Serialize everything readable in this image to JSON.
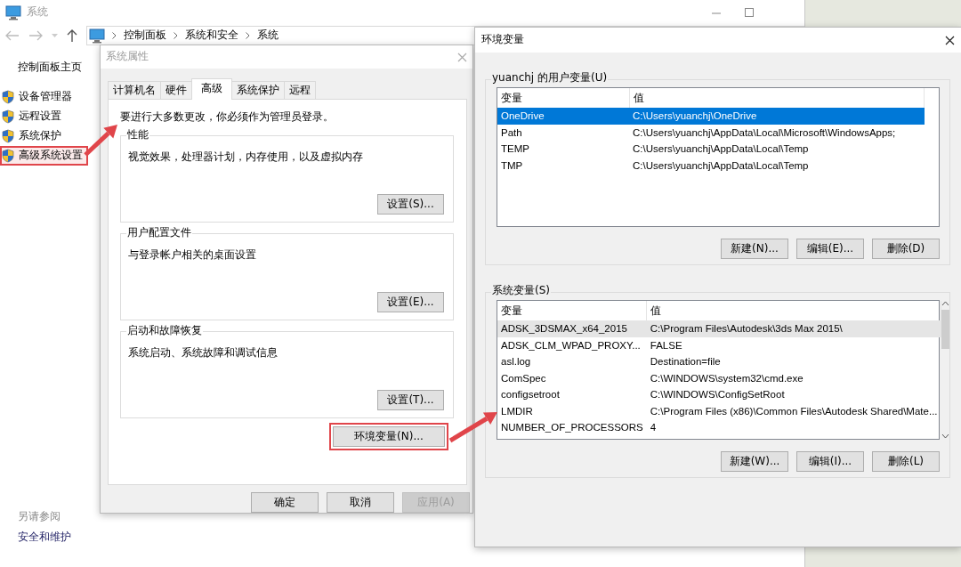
{
  "system_window": {
    "title": "系统",
    "breadcrumb": [
      "控制面板",
      "系统和安全",
      "系统"
    ],
    "sidebar": {
      "home": "控制面板主页",
      "items": [
        {
          "label": "设备管理器",
          "highlighted": false
        },
        {
          "label": "远程设置",
          "highlighted": false
        },
        {
          "label": "系统保护",
          "highlighted": false
        },
        {
          "label": "高级系统设置",
          "highlighted": true
        }
      ],
      "see_also": "另请参阅",
      "links": [
        "安全和维护"
      ]
    }
  },
  "properties_dialog": {
    "title": "系统属性",
    "tabs": [
      {
        "label": "计算机名",
        "selected": false
      },
      {
        "label": "硬件",
        "selected": false
      },
      {
        "label": "高级",
        "selected": true
      },
      {
        "label": "系统保护",
        "selected": false
      },
      {
        "label": "远程",
        "selected": false
      }
    ],
    "notice": "要进行大多数更改，你必须作为管理员登录。",
    "groups": [
      {
        "title": "性能",
        "description": "视觉效果，处理器计划，内存使用，以及虚拟内存",
        "button": "设置(S)..."
      },
      {
        "title": "用户配置文件",
        "description": "与登录帐户相关的桌面设置",
        "button": "设置(E)..."
      },
      {
        "title": "启动和故障恢复",
        "description": "系统启动、系统故障和调试信息",
        "button": "设置(T)..."
      }
    ],
    "env_button": {
      "label": "环境变量(N)...",
      "highlighted": true
    },
    "buttons": [
      {
        "label": "确定",
        "disabled": false
      },
      {
        "label": "取消",
        "disabled": false
      },
      {
        "label": "应用(A)",
        "disabled": true
      }
    ]
  },
  "env_dialog": {
    "title": "环境变量",
    "sections": [
      {
        "title": "yuanchj 的用户变量(U)",
        "focused": true,
        "scrollbar": false,
        "columns": [
          "变量",
          "值"
        ],
        "rows": [
          {
            "name": "OneDrive",
            "value": "C:\\Users\\yuanchj\\OneDrive",
            "selected": true
          },
          {
            "name": "Path",
            "value": "C:\\Users\\yuanchj\\AppData\\Local\\Microsoft\\WindowsApps;",
            "selected": false
          },
          {
            "name": "TEMP",
            "value": "C:\\Users\\yuanchj\\AppData\\Local\\Temp",
            "selected": false
          },
          {
            "name": "TMP",
            "value": "C:\\Users\\yuanchj\\AppData\\Local\\Temp",
            "selected": false
          }
        ],
        "buttons": [
          "新建(N)...",
          "编辑(E)...",
          "删除(D)"
        ]
      },
      {
        "title": "系统变量(S)",
        "focused": false,
        "scrollbar": true,
        "columns": [
          "变量",
          "值"
        ],
        "rows": [
          {
            "name": "ADSK_3DSMAX_x64_2015",
            "value": "C:\\Program Files\\Autodesk\\3ds Max 2015\\",
            "selected": true
          },
          {
            "name": "ADSK_CLM_WPAD_PROXY...",
            "value": "FALSE",
            "selected": false
          },
          {
            "name": "asl.log",
            "value": "Destination=file",
            "selected": false
          },
          {
            "name": "ComSpec",
            "value": "C:\\WINDOWS\\system32\\cmd.exe",
            "selected": false
          },
          {
            "name": "configsetroot",
            "value": "C:\\WINDOWS\\ConfigSetRoot",
            "selected": false
          },
          {
            "name": "LMDIR",
            "value": "C:\\Program Files (x86)\\Common Files\\Autodesk Shared\\Mate...",
            "selected": false
          },
          {
            "name": "NUMBER_OF_PROCESSORS",
            "value": "4",
            "selected": false
          }
        ],
        "buttons": [
          "新建(W)...",
          "编辑(I)...",
          "删除(L)"
        ]
      }
    ]
  }
}
